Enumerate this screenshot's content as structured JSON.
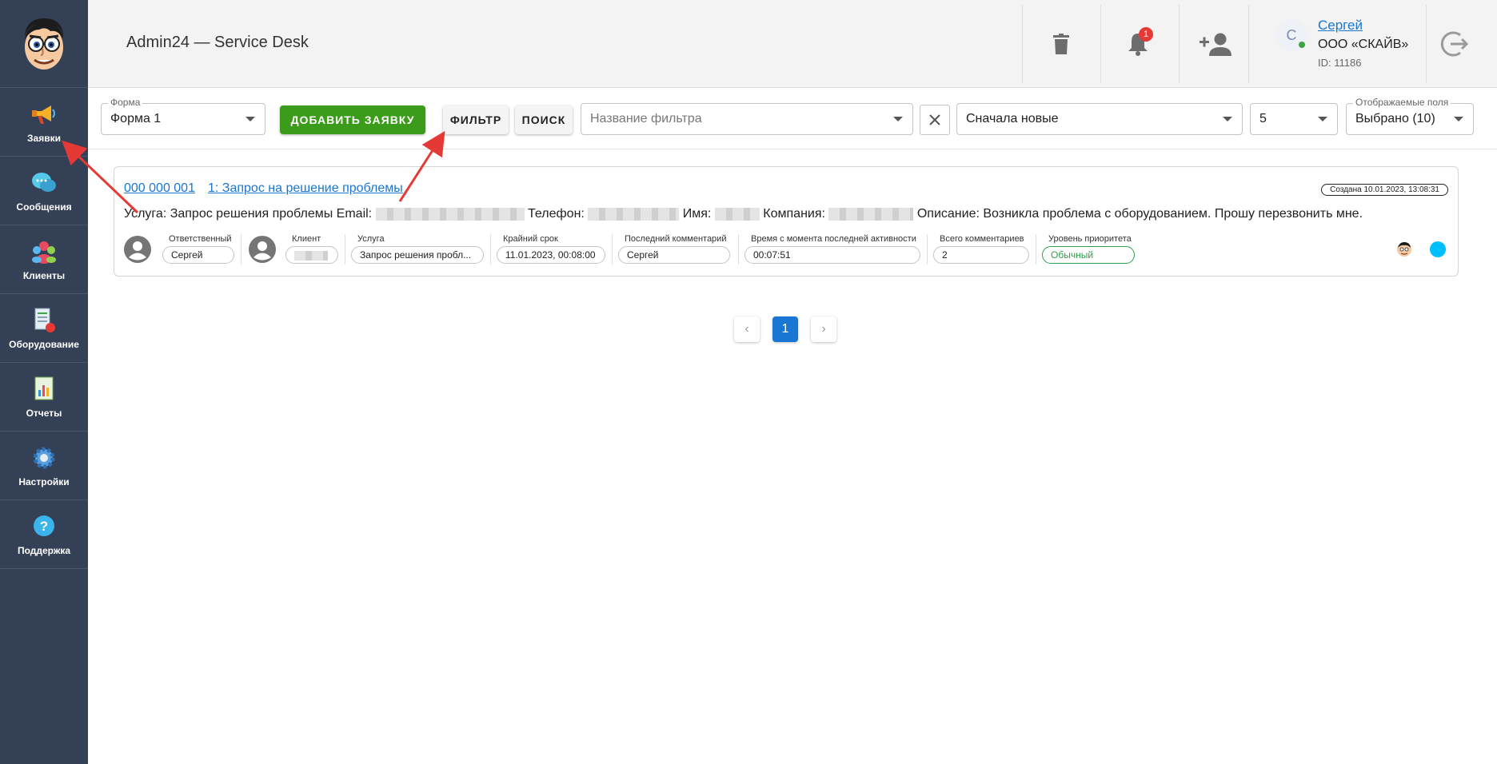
{
  "sidebar": {
    "items": [
      {
        "label": "Заявки",
        "icon": "megaphone-icon"
      },
      {
        "label": "Сообщения",
        "icon": "chat-bubbles-icon"
      },
      {
        "label": "Клиенты",
        "icon": "people-icon"
      },
      {
        "label": "Оборудование",
        "icon": "equipment-icon"
      },
      {
        "label": "Отчеты",
        "icon": "report-icon"
      },
      {
        "label": "Настройки",
        "icon": "gear-icon"
      },
      {
        "label": "Поддержка",
        "icon": "help-icon"
      }
    ]
  },
  "header": {
    "title": "Admin24 — Service Desk",
    "notification_count": "1",
    "user": {
      "initial": "С",
      "name": "Сергей",
      "company": "ООО «СКАЙВ»",
      "id": "ID: 11186"
    }
  },
  "toolbar": {
    "form_label": "Форма",
    "form_value": "Форма 1",
    "add_ticket": "ДОБАВИТЬ ЗАЯВКУ",
    "filter": "ФИЛЬТР",
    "search": "ПОИСК",
    "filter_name_placeholder": "Название фильтра",
    "sort_value": "Сначала новые",
    "page_size": "5",
    "fields_label": "Отображаемые поля",
    "fields_value": "Выбрано (10)"
  },
  "ticket": {
    "number": "000 000 001",
    "title": "1: Запрос на решение проблемы",
    "created": "Создана 10.01.2023, 13:08:31",
    "desc_service": "Услуга: Запрос решения проблемы Email:",
    "desc_phone": "Телефон:",
    "desc_name": "Имя:",
    "desc_company": "Компания:",
    "desc_description": "Описание: Возникла проблема с оборудованием. Прошу перезвонить мне.",
    "meta": {
      "responsible_label": "Ответственный",
      "responsible_value": "Сергей",
      "client_label": "Клиент",
      "service_label": "Услуга",
      "service_value": "Запрос решения пробл...",
      "deadline_label": "Крайний срок",
      "deadline_value": "11.01.2023, 00:08:00",
      "last_comment_label": "Последний комментарий",
      "last_comment_value": "Сергей",
      "since_activity_label": "Время с момента последней активности",
      "since_activity_value": "00:07:51",
      "total_comments_label": "Всего комментариев",
      "total_comments_value": "2",
      "priority_label": "Уровень приоритета",
      "priority_value": "Обычный"
    },
    "status_color": "#00bfff"
  },
  "pagination": {
    "current": "1",
    "prev": "‹",
    "next": "›"
  },
  "colors": {
    "sidebar": "#344055",
    "accent": "#1976d2",
    "add_button": "#3b9b1a",
    "priority": "#2e9e4a",
    "annotation_arrow": "#e53935"
  }
}
